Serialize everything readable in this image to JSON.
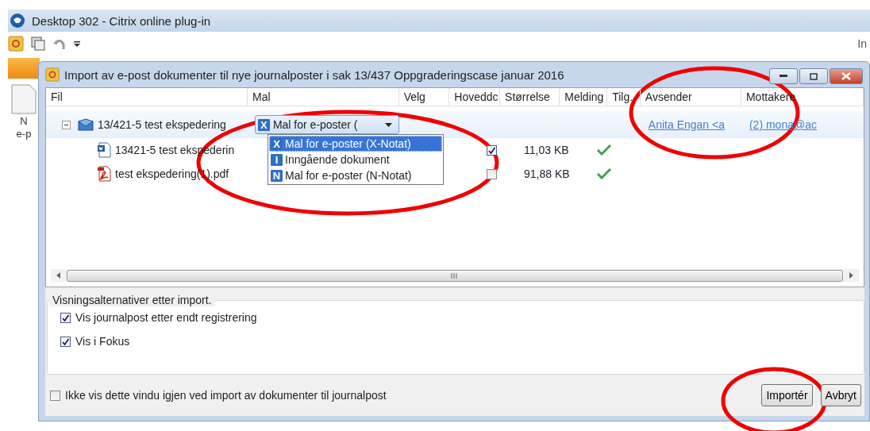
{
  "app_window": {
    "title": "Desktop 302 - Citrix online plug-in",
    "toolbar_right_text": "In",
    "side_labels": [
      "N",
      "e-p"
    ]
  },
  "dialog": {
    "title": "Import av e-post dokumenter til nye journalposter i sak 13/437 Oppgraderingscase januar 2016"
  },
  "table": {
    "columns": [
      "Fil",
      "Mal",
      "Velg",
      "Hoveddc",
      "Størrelse",
      "Melding",
      "Tilg.",
      "Avsender",
      "Mottakere"
    ],
    "rows": [
      {
        "kind": "email",
        "name": "13/421-5 test ekspedering",
        "expanded": true,
        "template": {
          "badge": "X",
          "text": "Mal for e-poster ("
        },
        "sender": "Anita Engan <a",
        "recipients": "(2) mona@ac",
        "children": [
          {
            "kind": "word",
            "name": "13421-5 test ekspederin",
            "main_document": true,
            "size": "11,03 KB",
            "message_ok": true
          },
          {
            "kind": "pdf",
            "name": "test ekspedering(1).pdf",
            "main_document": false,
            "size": "91,88 KB",
            "message_ok": true
          }
        ]
      }
    ]
  },
  "template_dropdown": {
    "options": [
      {
        "badge": "X",
        "label": "Mal for e-poster (X-Notat)",
        "selected": true
      },
      {
        "badge": "I",
        "label": "Inngående dokument",
        "selected": false
      },
      {
        "badge": "N",
        "label": "Mal for e-poster (N-Notat)",
        "selected": false
      }
    ]
  },
  "display_options": {
    "legend": "Visningsalternativer etter import.",
    "options": [
      {
        "label": "Vis journalpost etter endt registrering",
        "checked": true
      },
      {
        "label": "Vis i Fokus",
        "checked": true
      }
    ]
  },
  "footer": {
    "label": "Ikke vis dette vindu igjen ved import av dokumenter til journalpost",
    "checked": false
  },
  "buttons": [
    {
      "label": "Importér"
    },
    {
      "label": "Avbryt"
    }
  ],
  "annotations": [
    {
      "kind": "ellipse"
    },
    {
      "kind": "ellipse"
    },
    {
      "kind": "ellipse"
    }
  ]
}
